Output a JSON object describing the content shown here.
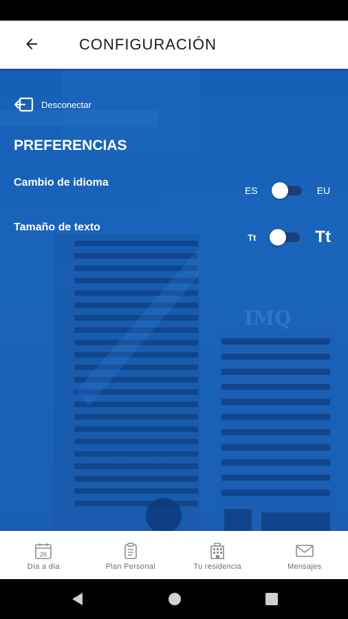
{
  "app_bar": {
    "title": "CONFIGURACIÓN",
    "back_icon": "arrow-left-icon"
  },
  "logout": {
    "label": "Desconectar",
    "icon": "logout-icon"
  },
  "preferences": {
    "title": "PREFERENCIAS",
    "language": {
      "label": "Cambio de idioma",
      "left": "ES",
      "right": "EU",
      "selected": "ES"
    },
    "text_size": {
      "label": "Tamaño de texto",
      "left": "Tt",
      "right": "Tt",
      "selected": "small"
    }
  },
  "background": {
    "building_sign": "IMQ"
  },
  "bottom_nav": [
    {
      "label": "Día a día",
      "icon": "calendar-icon",
      "calendar_day": "26"
    },
    {
      "label": "Plan Personal",
      "icon": "clipboard-icon"
    },
    {
      "label": "Tu residencia",
      "icon": "building-icon"
    },
    {
      "label": "Mensajes",
      "icon": "envelope-icon"
    }
  ],
  "colors": {
    "accent_blue": "#1a64ba",
    "toggle_track": "#1b3f7a",
    "nav_gray": "#6a6a6a"
  }
}
